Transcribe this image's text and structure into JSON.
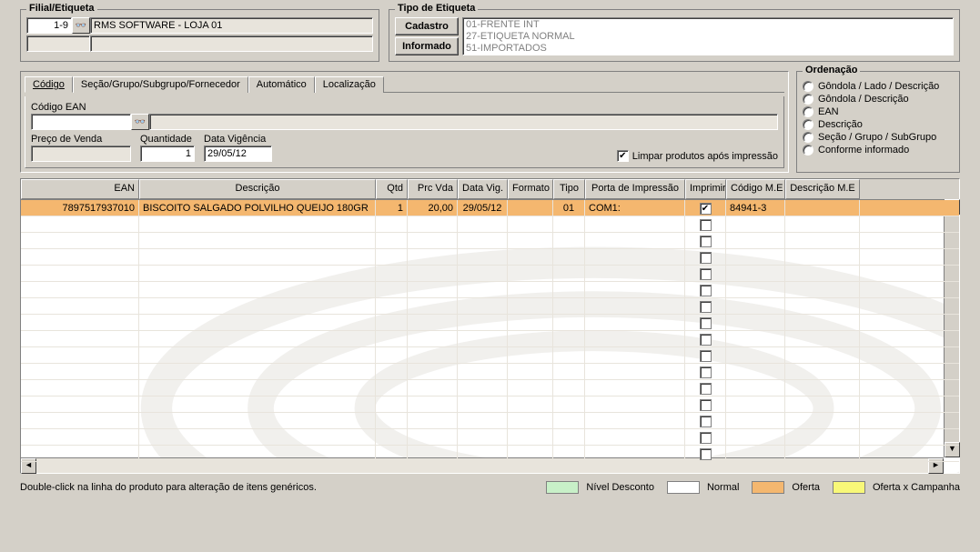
{
  "filial": {
    "legend": "Filial/Etiqueta",
    "code": "1-9",
    "name": "RMS SOFTWARE - LOJA 01"
  },
  "tipo": {
    "legend": "Tipo de Etiqueta",
    "btn_cadastro": "Cadastro",
    "btn_informado": "Informado",
    "options": [
      "01-FRENTE INT",
      "27-ETIQUETA NORMAL",
      "51-IMPORTADOS"
    ]
  },
  "tabs": {
    "codigo": "Código",
    "secao": "Seção/Grupo/Subgrupo/Fornecedor",
    "automatico": "Automático",
    "localizacao": "Localização"
  },
  "search": {
    "ean_label": "Código EAN",
    "preco_label": "Preço de Venda",
    "qtd_label": "Quantidade",
    "qtd_value": "1",
    "data_label": "Data Vigência",
    "data_value": "29/05/12",
    "limpar_label": "Limpar produtos após impressão"
  },
  "ordenacao": {
    "legend": "Ordenação",
    "options": [
      "Gôndola / Lado / Descrição",
      "Gôndola / Descrição",
      "EAN",
      "Descrição",
      "Seção / Grupo / SubGrupo",
      "Conforme informado"
    ]
  },
  "grid": {
    "headers": {
      "ean": "EAN",
      "desc": "Descrição",
      "qtd": "Qtd",
      "prc": "Prc Vda",
      "data": "Data Vig.",
      "fmt": "Formato",
      "tipo": "Tipo",
      "porta": "Porta de Impressão",
      "imp": "Imprimir",
      "codme": "Código M.E",
      "descme": "Descrição M.E"
    },
    "rows": [
      {
        "ean": "7897517937010",
        "desc": "BISCOITO SALGADO POLVILHO QUEIJO 180GR",
        "qtd": "1",
        "prc": "20,00",
        "data": "29/05/12",
        "fmt": "",
        "tipo": "01",
        "porta": "COM1:",
        "imprimir": true,
        "codme": "84941-3",
        "descme": ""
      }
    ]
  },
  "footer": {
    "hint": "Double-click na linha do produto para alteração de itens genéricos.",
    "legend": {
      "nivel": "Nível Desconto",
      "normal": "Normal",
      "oferta": "Oferta",
      "campanha": "Oferta x Campanha"
    }
  },
  "colors": {
    "nivel": "#c8f0c8",
    "normal": "#ffffff",
    "oferta": "#f4b76f",
    "campanha": "#f8f878"
  },
  "icons": {
    "binoculars": "🔍"
  }
}
